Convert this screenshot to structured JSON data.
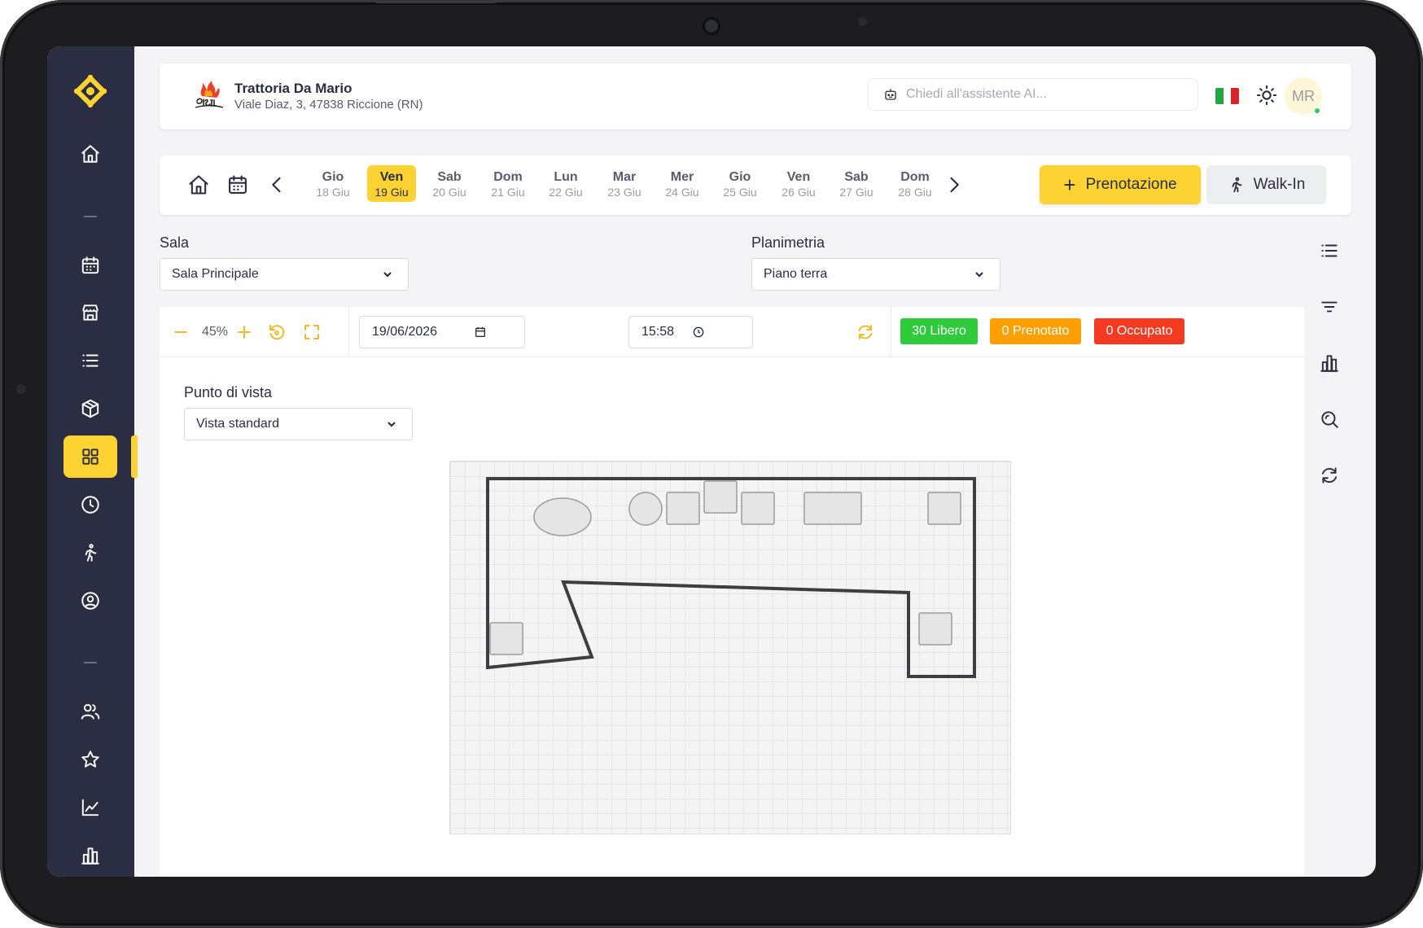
{
  "colors": {
    "accent": "#fdd333",
    "sidebar": "#2b2d42",
    "free": "#2fcb3a",
    "booked": "#ffa000",
    "occupied": "#f53a22"
  },
  "sidebar": {
    "items": [
      {
        "name": "home-icon"
      },
      {
        "name": "calendar-icon"
      },
      {
        "name": "store-icon"
      },
      {
        "name": "list-icon"
      },
      {
        "name": "box-icon"
      },
      {
        "name": "grid-icon",
        "active": true
      },
      {
        "name": "clock-icon"
      },
      {
        "name": "walk-icon"
      },
      {
        "name": "user-circle-icon"
      },
      {
        "name": "users-icon"
      },
      {
        "name": "star-icon"
      },
      {
        "name": "line-chart-icon"
      },
      {
        "name": "bar-chart-icon"
      }
    ]
  },
  "header": {
    "restaurant_name": "Trattoria Da Mario",
    "restaurant_address": "Viale Diaz, 3, 47838 Riccione (RN)",
    "ai_placeholder": "Chiedi all'assistente AI...",
    "language": "it",
    "user_initials": "MR"
  },
  "datebar": {
    "days": [
      {
        "name": "Gio",
        "date": "18 Giu"
      },
      {
        "name": "Ven",
        "date": "19 Giu",
        "selected": true
      },
      {
        "name": "Sab",
        "date": "20 Giu"
      },
      {
        "name": "Dom",
        "date": "21 Giu"
      },
      {
        "name": "Lun",
        "date": "22 Giu"
      },
      {
        "name": "Mar",
        "date": "23 Giu"
      },
      {
        "name": "Mer",
        "date": "24 Giu"
      },
      {
        "name": "Gio",
        "date": "25 Giu"
      },
      {
        "name": "Ven",
        "date": "26 Giu"
      },
      {
        "name": "Sab",
        "date": "27 Giu"
      },
      {
        "name": "Dom",
        "date": "28 Giu"
      }
    ],
    "new_booking_label": "Prenotazione",
    "walkin_label": "Walk-In"
  },
  "filters": {
    "sala_label": "Sala",
    "sala_value": "Sala Principale",
    "planimetria_label": "Planimetria",
    "planimetria_value": "Piano terra"
  },
  "toolbar": {
    "zoom": "45%",
    "date": "19/06/2026",
    "time": "15:58",
    "free_badge": "30 Libero",
    "booked_badge": "0 Prenotato",
    "occupied_badge": "0 Occupato"
  },
  "view": {
    "label": "Punto di vista",
    "value": "Vista standard"
  }
}
